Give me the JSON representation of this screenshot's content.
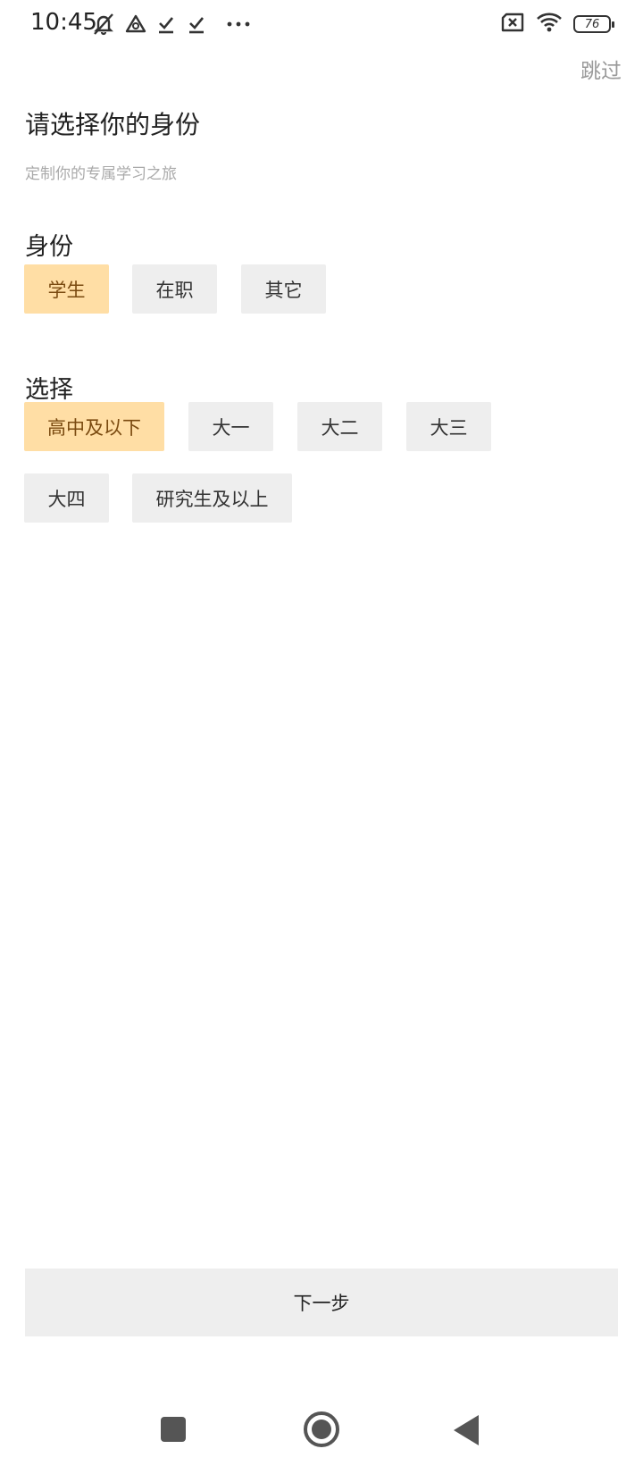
{
  "status_bar": {
    "time": "10:45",
    "left_icons": [
      "mute-icon",
      "app-notification-icon",
      "download-done-icon",
      "download-done-icon",
      "more-icon"
    ],
    "right_icons": [
      "no-sim-icon",
      "wifi-icon",
      "battery-icon"
    ],
    "battery_level": "76"
  },
  "header": {
    "skip_label": "跳过",
    "title": "请选择你的身份",
    "subtitle": "定制你的专属学习之旅"
  },
  "identity": {
    "label": "身份",
    "options": [
      "学生",
      "在职",
      "其它"
    ],
    "selected": "学生"
  },
  "grade": {
    "label": "选择",
    "options": [
      "高中及以下",
      "大一",
      "大二",
      "大三",
      "大四",
      "研究生及以上"
    ],
    "selected": "高中及以下"
  },
  "footer": {
    "next_label": "下一步"
  },
  "colors": {
    "selected_bg": "#ffdea5",
    "selected_text": "#7a4a10",
    "chip_bg": "#eeeeee",
    "muted_text": "#999999"
  }
}
